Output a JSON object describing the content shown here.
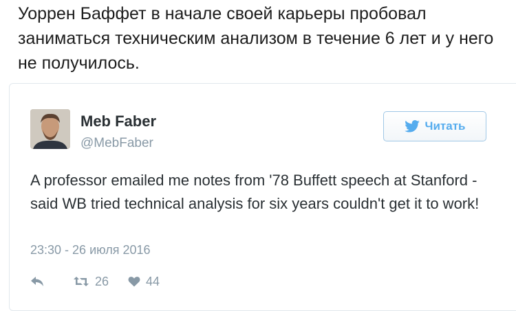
{
  "post": {
    "text": "Уоррен Баффет в начале своей карьеры пробовал заниматься техническим анализом в течение 6 лет и у него не получилось."
  },
  "tweet": {
    "author_name": "Meb Faber",
    "author_handle": "@MebFaber",
    "follow_label": "Читать",
    "text": "A professor emailed me notes from '78 Buffett speech at Stanford - said WB tried technical analysis for six years couldn't get it to work!",
    "timestamp": "23:30 - 26 июля 2016",
    "retweets": "26",
    "likes": "44"
  },
  "icons": {
    "follow": "twitter-bird-icon",
    "reply": "reply-icon",
    "retweet": "retweet-icon",
    "like": "heart-icon"
  },
  "colors": {
    "twitter_blue": "#55acee",
    "muted": "#8899a6",
    "text": "#292f33"
  }
}
